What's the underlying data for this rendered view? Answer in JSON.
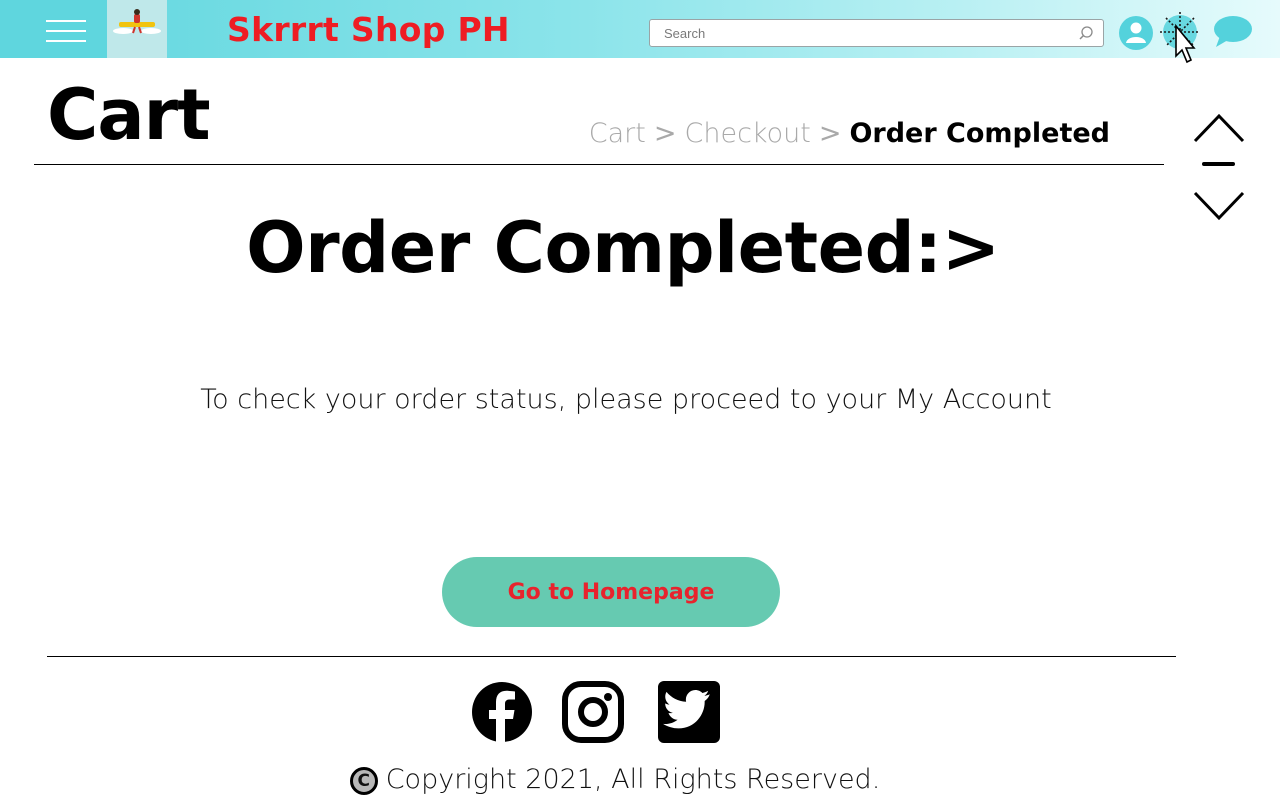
{
  "header": {
    "brand": "Skrrrt Shop PH",
    "search_placeholder": "Search",
    "icons": [
      "hamburger-menu-icon",
      "logo",
      "user-icon",
      "settings-icon",
      "chat-icon"
    ]
  },
  "page": {
    "heading": "Cart",
    "breadcrumb": {
      "step1": "Cart",
      "separator": ">",
      "step2": "Checkout",
      "current": "Order Completed"
    }
  },
  "main": {
    "title": "Order Completed:>",
    "message": "To check your order status, please proceed to your My Account",
    "button_label": "Go to Homepage"
  },
  "footer": {
    "social": [
      "facebook-icon",
      "instagram-icon",
      "twitter-icon"
    ],
    "copyright_symbol": "C",
    "copyright": "Copyright 2021, All Rights Reserved."
  },
  "colors": {
    "brand_red": "#ee1d23",
    "header_teal": "#5fd6de",
    "button_green": "#66cab1",
    "icon_cyan": "#54d2dc"
  }
}
